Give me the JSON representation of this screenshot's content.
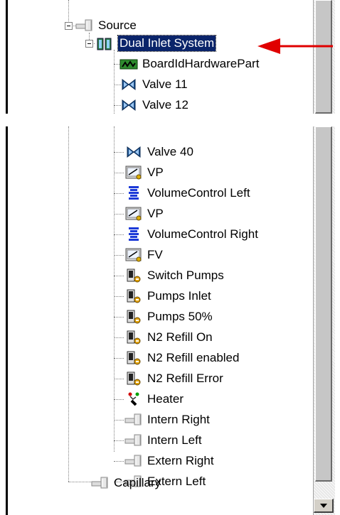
{
  "tree_top": {
    "items": [
      {
        "label": "Source",
        "icon": "pipe-icon"
      },
      {
        "label": "Dual Inlet System",
        "icon": "dual-inlet-icon"
      },
      {
        "label": "BoardIdHardwarePart",
        "icon": "board-icon"
      },
      {
        "label": "Valve 11",
        "icon": "valve-icon"
      },
      {
        "label": "Valve 12",
        "icon": "valve-icon"
      }
    ]
  },
  "tree_bottom": {
    "items": [
      {
        "label": "Valve 40",
        "icon": "valve-icon"
      },
      {
        "label": "VP",
        "icon": "pressure-gauge-icon"
      },
      {
        "label": "VolumeControl Left",
        "icon": "bellows-icon"
      },
      {
        "label": "VP",
        "icon": "pressure-gauge-icon"
      },
      {
        "label": "VolumeControl Right",
        "icon": "bellows-icon"
      },
      {
        "label": "FV",
        "icon": "pressure-gauge-icon"
      },
      {
        "label": "Switch Pumps",
        "icon": "switch-icon"
      },
      {
        "label": "Pumps Inlet",
        "icon": "switch-icon"
      },
      {
        "label": "Pumps 50%",
        "icon": "switch-icon"
      },
      {
        "label": "N2 Refill On",
        "icon": "switch-icon"
      },
      {
        "label": "N2 Refill enabled",
        "icon": "switch-icon"
      },
      {
        "label": "N2 Refill Error",
        "icon": "switch-icon"
      },
      {
        "label": "Heater",
        "icon": "heater-icon"
      },
      {
        "label": "Intern Right",
        "icon": "pipe-icon"
      },
      {
        "label": "Intern Left",
        "icon": "pipe-icon"
      },
      {
        "label": "Extern Right",
        "icon": "pipe-icon"
      },
      {
        "label": "Extern Left",
        "icon": "pipe-icon"
      },
      {
        "label": "Capillary",
        "icon": "pipe-icon"
      }
    ]
  },
  "colors": {
    "selection": "#0a246a",
    "arrow": "#e00000",
    "valve": "#1a4e8a",
    "bellows": "#1c3ad8",
    "board": "#2e8b2e"
  }
}
